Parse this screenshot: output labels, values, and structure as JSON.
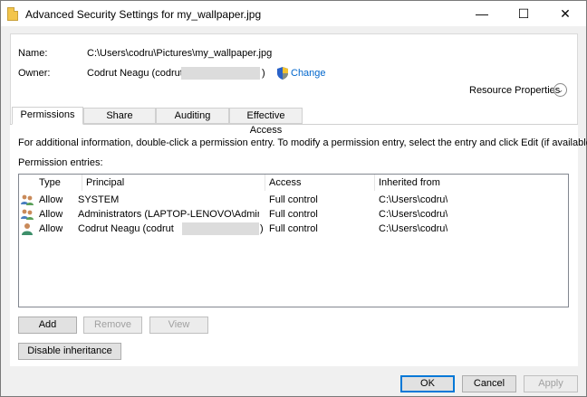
{
  "window": {
    "title": "Advanced Security Settings for my_wallpaper.jpg",
    "min_glyph": "—",
    "max_glyph": "☐",
    "close_glyph": "✕"
  },
  "info": {
    "name_label": "Name:",
    "name_value": "C:\\Users\\codru\\Pictures\\my_wallpaper.jpg",
    "owner_label": "Owner:",
    "owner_value_prefix": "Codrut Neagu (codrut_",
    "owner_value_suffix": ")",
    "change_link": "Change",
    "resource_properties": "Resource Properties"
  },
  "tabs": [
    {
      "label": "Permissions",
      "active": true
    },
    {
      "label": "Share",
      "active": false
    },
    {
      "label": "Auditing",
      "active": false
    },
    {
      "label": "Effective Access",
      "active": false
    }
  ],
  "permissions": {
    "instructions": "For additional information, double-click a permission entry. To modify a permission entry, select the entry and click Edit (if available).",
    "entries_label": "Permission entries:",
    "columns": [
      "Type",
      "Principal",
      "Access",
      "Inherited from"
    ],
    "rows": [
      {
        "type": "Allow",
        "principal": "SYSTEM",
        "access": "Full control",
        "inherited": "C:\\Users\\codru\\",
        "icon": "group-users-icon"
      },
      {
        "type": "Allow",
        "principal": "Administrators (LAPTOP-LENOVO\\Administrators)",
        "access": "Full control",
        "inherited": "C:\\Users\\codru\\",
        "icon": "group-users-icon"
      },
      {
        "type": "Allow",
        "principal": "Codrut Neagu (codrut",
        "principal_suffix": ")",
        "access": "Full control",
        "inherited": "C:\\Users\\codru\\",
        "icon": "user-icon"
      }
    ],
    "add_button": "Add",
    "remove_button": "Remove",
    "view_button": "View",
    "disable_inheritance_button": "Disable inheritance"
  },
  "footer": {
    "ok": "OK",
    "cancel": "Cancel",
    "apply": "Apply"
  },
  "colors": {
    "link": "#0066cc",
    "accent": "#0078d7"
  }
}
